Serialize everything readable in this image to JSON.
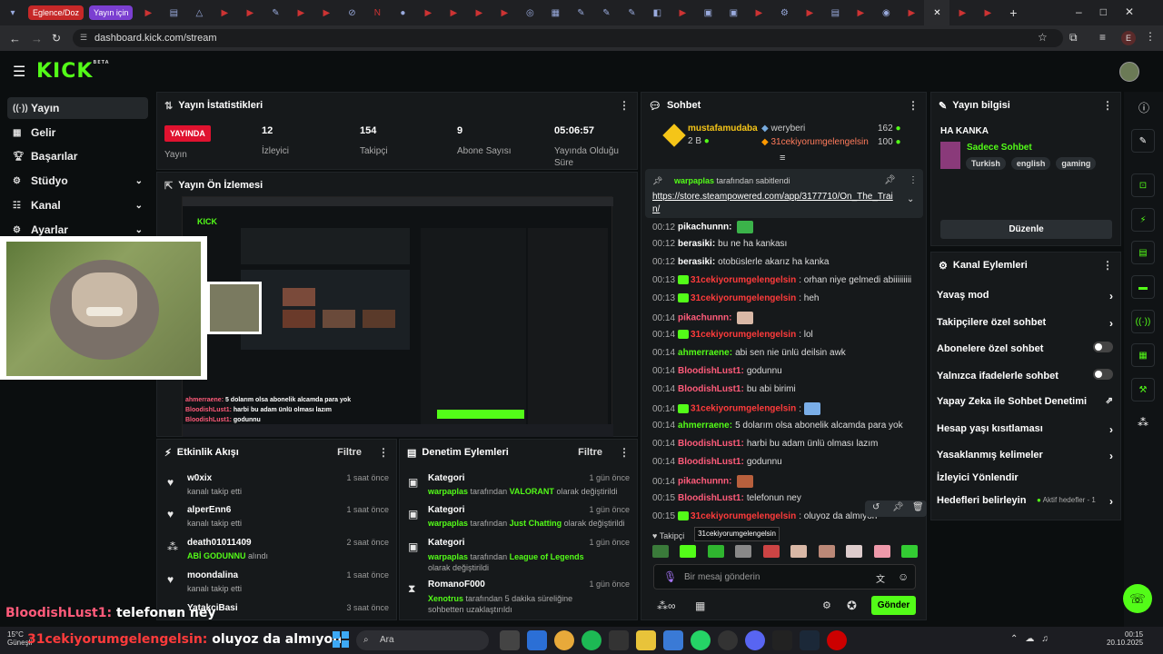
{
  "browser": {
    "tab_chips": [
      {
        "label": "Eglence/Doz",
        "color": "#c62828"
      },
      {
        "label": "Yayın için",
        "color": "#7b3fd1"
      }
    ],
    "url": "dashboard.kick.com/stream",
    "profile_letter": "E"
  },
  "sidebar": {
    "items": [
      {
        "label": "Yayın",
        "icon": "broadcast-icon",
        "active": true
      },
      {
        "label": "Gelir",
        "icon": "revenue-icon"
      },
      {
        "label": "Başarılar",
        "icon": "trophy-icon"
      },
      {
        "label": "Stüdyo",
        "icon": "studio-icon",
        "expandable": true
      },
      {
        "label": "Kanal",
        "icon": "channel-icon",
        "expandable": true
      },
      {
        "label": "Ayarlar",
        "icon": "settings-icon",
        "expandable": true
      }
    ]
  },
  "stats": {
    "title": "Yayın İstatistikleri",
    "live_label": "YAYINDA",
    "live_sub": "Yayın",
    "viewers": {
      "value": "12",
      "label": "İzleyici"
    },
    "followers": {
      "value": "154",
      "label": "Takipçi"
    },
    "subs": {
      "value": "9",
      "label": "Abone Sayısı"
    },
    "uptime": {
      "value": "05:06:57",
      "label": "Yayında Olduğu Süre"
    }
  },
  "preview": {
    "title": "Yayın Ön İzlemesi"
  },
  "activity": {
    "title": "Etkinlik Akışı",
    "filter": "Filtre",
    "items": [
      {
        "name": "w0xix",
        "sub": "kanalı takip etti",
        "time": "1 saat önce"
      },
      {
        "name": "alperEnn6",
        "sub": "kanalı takip etti",
        "time": "1 saat önce"
      },
      {
        "name": "death01011409",
        "sub_highlight": "ABİ GODUNNU",
        "sub": "alındı",
        "time": "2 saat önce"
      },
      {
        "name": "moondalina",
        "sub": "kanalı takip etti",
        "time": "1 saat önce"
      },
      {
        "name": "YatakciBasi",
        "sub": "",
        "time": "3 saat önce"
      }
    ]
  },
  "moderation": {
    "title": "Denetim Eylemleri",
    "filter": "Filtre",
    "items": [
      {
        "name": "Kategori",
        "user": "warpaplas",
        "mid": "tarafından",
        "target": "VALORANT",
        "end": "olarak değiştirildi",
        "time": "1 gün önce"
      },
      {
        "name": "Kategori",
        "user": "warpaplas",
        "mid": "tarafından",
        "target": "Just Chatting",
        "end": "olarak değiştirildi",
        "time": "1 gün önce"
      },
      {
        "name": "Kategori",
        "user": "warpaplas",
        "mid": "tarafından",
        "target": "League of Legends",
        "end": "olarak değiştirildi",
        "time": "1 gün önce"
      },
      {
        "name": "RomanoF000",
        "user": "Xenotrus",
        "mid": "tarafından 5 dakika süreliğine sohbetten",
        "target": "",
        "end": "uzaklaştırıldı",
        "time": "1 gün önce"
      }
    ]
  },
  "chat": {
    "title": "Sohbet",
    "leaders": [
      {
        "name": "mustafamudaba",
        "sub": "2 B"
      },
      {
        "name": "weryberi",
        "count": "162"
      },
      {
        "name": "31cekiyorumgelengelsin",
        "count": "100"
      }
    ],
    "pinned": {
      "by": "warpaplas",
      "by_suffix": "tarafından sabitlendi",
      "link": "https://store.steampowered.com/app/3177710/On_The_Train/"
    },
    "messages": [
      {
        "time": "00:12",
        "user": "pikachunnn:",
        "text": "",
        "cls": "u-white",
        "emote": "#3bb34a"
      },
      {
        "time": "00:12",
        "user": "berasiki:",
        "text": "bu ne ha kankası",
        "cls": "u-white"
      },
      {
        "time": "00:12",
        "user": "berasiki:",
        "text": "otobüslerle akarız ha kanka",
        "cls": "u-white"
      },
      {
        "time": "00:13",
        "user": "31cekiyorumgelengelsin",
        "text": ": orhan niye gelmedi abiiiiiiiii",
        "cls": "u-red",
        "badge": true
      },
      {
        "time": "00:13",
        "user": "31cekiyorumgelengelsin",
        "text": ": heh",
        "cls": "u-red",
        "badge": true
      },
      {
        "time": "00:14",
        "user": "pikachunnn:",
        "text": "",
        "cls": "u-pink",
        "emote": "#d9b8a6"
      },
      {
        "time": "00:14",
        "user": "31cekiyorumgelengelsin",
        "text": ": lol",
        "cls": "u-red",
        "badge": true
      },
      {
        "time": "00:14",
        "user": "ahmerraene:",
        "text": "abi sen nie ünlü deilsin awk",
        "cls": "u-green"
      },
      {
        "time": "00:14",
        "user": "BloodishLust1:",
        "text": "godunnu",
        "cls": "u-pink"
      },
      {
        "time": "00:14",
        "user": "BloodishLust1:",
        "text": "bu abi birimi",
        "cls": "u-pink"
      },
      {
        "time": "00:14",
        "user": "31cekiyorumgelengelsin",
        "text": ":",
        "cls": "u-red",
        "badge": true,
        "emote": "#7aaee8"
      },
      {
        "time": "00:14",
        "user": "ahmerraene:",
        "text": "5 dolarım olsa abonelik alcamda para yok",
        "cls": "u-green"
      },
      {
        "time": "00:14",
        "user": "BloodishLust1:",
        "text": "harbi bu adam ünlü olması lazım",
        "cls": "u-pink"
      },
      {
        "time": "00:14",
        "user": "BloodishLust1:",
        "text": "godunnu",
        "cls": "u-pink"
      },
      {
        "time": "00:14",
        "user": "pikachunnn:",
        "text": "",
        "cls": "u-pink",
        "emote": "#b8603d"
      },
      {
        "time": "00:15",
        "user": "BloodishLust1:",
        "text": "telefonun ney",
        "cls": "u-pink"
      },
      {
        "time": "00:15",
        "user": "31cekiyorumgelengelsin",
        "text": ": oluyoz da almıyon",
        "cls": "u-red",
        "badge": true
      }
    ],
    "tooltip": "31cekiyorumgelengelsin",
    "followers_only_prefix": "Takipçi",
    "input_placeholder": "Bir mesaj gönderin",
    "send": "Gönder"
  },
  "streaminfo": {
    "title": "Yayın bilgisi",
    "stream_title": "HA KANKA",
    "category": "Sadece Sohbet",
    "tags": [
      "Turkish",
      "english",
      "gaming"
    ],
    "edit": "Düzenle"
  },
  "channel_actions": {
    "title": "Kanal Eylemleri",
    "items": [
      {
        "label": "Yavaş mod",
        "kind": "arrow"
      },
      {
        "label": "Takipçilere özel sohbet",
        "kind": "arrow"
      },
      {
        "label": "Abonelere özel sohbet",
        "kind": "toggle"
      },
      {
        "label": "Yalnızca ifadelerle sohbet",
        "kind": "toggle"
      },
      {
        "label": "Yapay Zeka ile Sohbet Denetimi",
        "kind": "ext"
      },
      {
        "label": "Hesap yaşı kısıtlaması",
        "kind": "arrow"
      },
      {
        "label": "Yasaklanmış kelimeler",
        "kind": "arrow"
      },
      {
        "label": "İzleyici Yönlendir",
        "kind": "none"
      },
      {
        "label": "Hedefleri belirleyin",
        "kind": "arrow",
        "extra": "Aktif hedefler - 1"
      }
    ]
  },
  "overlay": {
    "line1_user": "BloodishLust1:",
    "line1_text": "telefonun ney",
    "line2_user": "31cekiyorumgelengelsin:",
    "line2_text": "oluyoz da almıyon"
  },
  "taskbar": {
    "weather": "15°C",
    "weather_sub": "Güneşli",
    "search": "Ara",
    "time": "00:15",
    "date": "20.10.2025"
  }
}
